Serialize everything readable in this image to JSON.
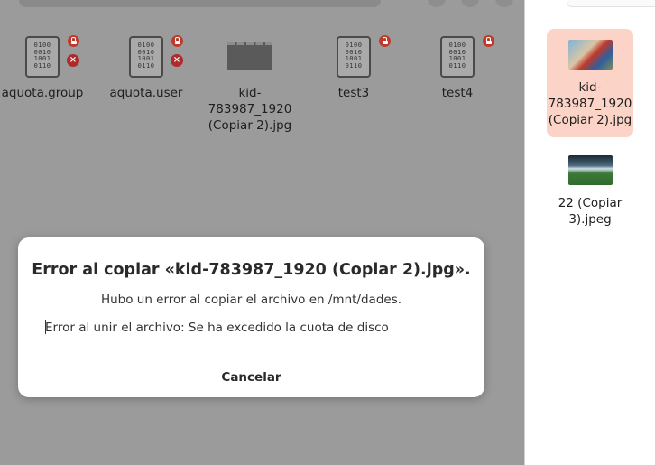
{
  "files": [
    {
      "name": "aquota.group",
      "type": "binary",
      "locked": true,
      "unreadable": true
    },
    {
      "name": "aquota.user",
      "type": "binary",
      "locked": true,
      "unreadable": true
    },
    {
      "name": "kid-783987_1920 (Copiar 2).jpg",
      "type": "image-partial"
    },
    {
      "name": "test3",
      "type": "binary",
      "locked": true
    },
    {
      "name": "test4",
      "type": "binary",
      "locked": true
    }
  ],
  "binary_glyph": "0100\n0010\n1001\n0110",
  "sidebar_files": [
    {
      "name": "kid-783987_1920 (Copiar 2).jpg",
      "selected": true
    },
    {
      "name": "22 (Copiar 3).jpeg",
      "selected": false
    }
  ],
  "dialog": {
    "title": "Error al copiar «kid-783987_1920 (Copiar 2).jpg».",
    "subtitle": "Hubo un error al copiar el archivo en /mnt/dades.",
    "detail": "Error al unir el archivo: Se ha excedido la cuota de disco",
    "cancel_label": "Cancelar"
  },
  "colors": {
    "dim_background": "#9b9b9b",
    "selection": "#fbd3c7",
    "lock_badge": "#c0392b"
  }
}
